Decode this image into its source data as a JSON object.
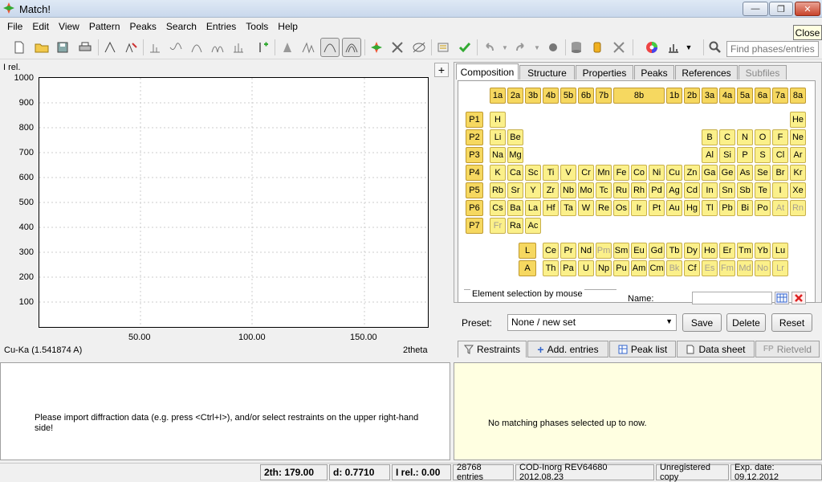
{
  "window": {
    "title": "Match!",
    "close_tooltip": "Close"
  },
  "menu": [
    "File",
    "Edit",
    "View",
    "Pattern",
    "Peaks",
    "Search",
    "Entries",
    "Tools",
    "Help"
  ],
  "toolbar": {
    "find_placeholder": "Find phases/entries"
  },
  "plot": {
    "ylabel": "I rel.",
    "xlabel": "2theta",
    "radiation": "Cu-Ka (1.541874 A)",
    "yticks": [
      "1000",
      "900",
      "800",
      "700",
      "600",
      "500",
      "400",
      "300",
      "200",
      "100"
    ],
    "xticks": [
      "50.00",
      "100.00",
      "150.00"
    ],
    "add_button": "+"
  },
  "tabs": [
    {
      "label": "Composition",
      "state": "active"
    },
    {
      "label": "Structure",
      "state": "normal"
    },
    {
      "label": "Properties",
      "state": "normal"
    },
    {
      "label": "Peaks",
      "state": "normal"
    },
    {
      "label": "References",
      "state": "normal"
    },
    {
      "label": "Subfiles",
      "state": "disabled"
    }
  ],
  "groups": [
    "1a",
    "2a",
    "3b",
    "4b",
    "5b",
    "6b",
    "7b",
    "8b",
    "1b",
    "2b",
    "3a",
    "4a",
    "5a",
    "6a",
    "7a",
    "8a"
  ],
  "periods": [
    "P1",
    "P2",
    "P3",
    "P4",
    "P5",
    "P6",
    "P7"
  ],
  "series_labels": [
    "L",
    "A"
  ],
  "element_selection": {
    "group_label": "Element selection by mouse",
    "name_label": "Name:"
  },
  "preset": {
    "label": "Preset:",
    "selected": "None / new set",
    "save": "Save",
    "delete": "Delete",
    "reset": "Reset"
  },
  "bottom_tabs": [
    {
      "label": "Restraints",
      "state": "active"
    },
    {
      "label": "Add. entries",
      "state": "normal"
    },
    {
      "label": "Peak list",
      "state": "normal"
    },
    {
      "label": "Data sheet",
      "state": "normal"
    },
    {
      "label": "Rietveld",
      "state": "disabled"
    }
  ],
  "messages": {
    "left": "Please import diffraction data (e.g. press <Ctrl+I>), and/or select restraints on the upper right-hand side!",
    "right": "No matching phases selected up to now."
  },
  "status": {
    "twotheta": "2th: 179.00",
    "d": "d: 0.7710",
    "irel": "I rel.: 0.00",
    "entries": "28768 entries",
    "database": "COD-Inorg REV64680 2012.08.23",
    "license": "Unregistered copy",
    "expiry": "Exp. date: 09.12.2012"
  },
  "colors": {
    "element_fill": "#fbf08a",
    "group_fill": "#f6d860",
    "message_bg": "#ffffe1"
  }
}
